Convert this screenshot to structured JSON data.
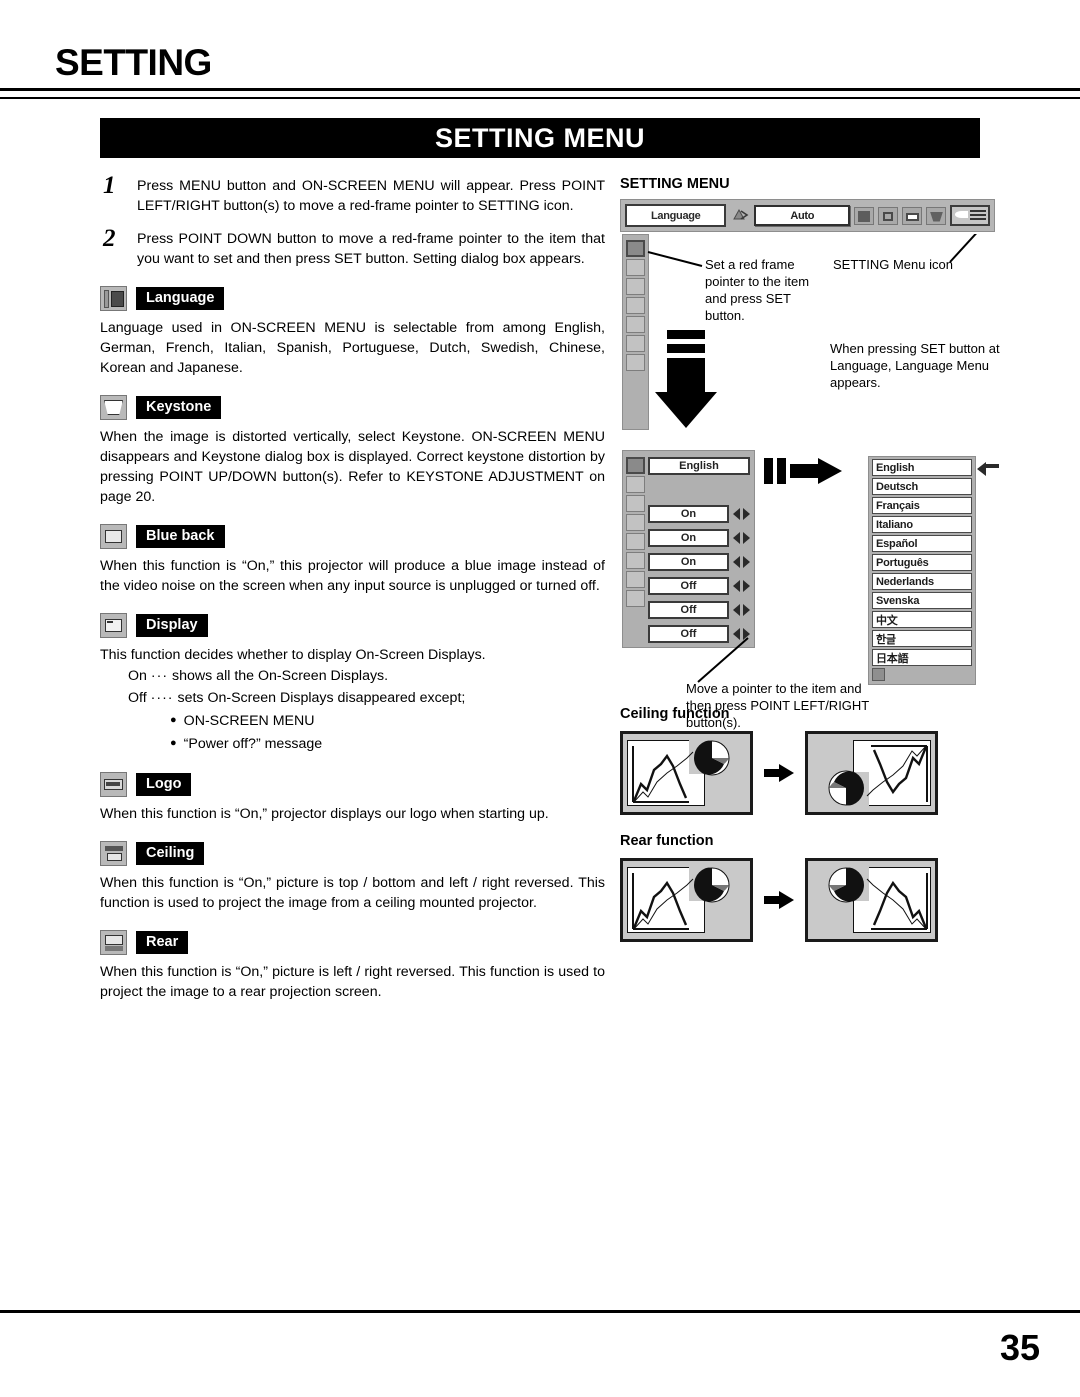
{
  "header": {
    "title": "SETTING",
    "banner": "SETTING MENU"
  },
  "steps": [
    {
      "num": "1",
      "text": "Press MENU button and ON-SCREEN MENU will appear.  Press POINT LEFT/RIGHT button(s) to move a red-frame pointer to SETTING icon."
    },
    {
      "num": "2",
      "text": "Press POINT DOWN button to move a red-frame pointer to the item that you want to set and then press SET button.  Setting dialog box appears."
    }
  ],
  "sections": [
    {
      "icon": "language-icon",
      "label": "Language",
      "body": "Language used in ON-SCREEN MENU is selectable from among English, German, French, Italian, Spanish, Portuguese, Dutch, Swedish, Chinese, Korean and Japanese."
    },
    {
      "icon": "keystone-icon",
      "label": "Keystone",
      "body": "When the image is distorted vertically, select Keystone.  ON-SCREEN MENU disappears and Keystone dialog box is displayed. Correct keystone distortion by pressing POINT UP/DOWN button(s). Refer to KEYSTONE ADJUSTMENT on page 20."
    },
    {
      "icon": "blue-back-icon",
      "label": "Blue back",
      "body": "When this function is “On,” this projector will produce a blue image instead of the video noise on the screen when any input source is unplugged or turned off."
    },
    {
      "icon": "display-icon",
      "label": "Display",
      "body": "This function decides whether to display On-Screen Displays.",
      "sub": [
        {
          "key": "On",
          "dots": "···",
          "text": "shows all the On-Screen Displays."
        },
        {
          "key": "Off",
          "dots": "····",
          "text": "sets On-Screen Displays disappeared except;"
        }
      ],
      "bullets": [
        "ON-SCREEN MENU",
        "“Power off?” message"
      ]
    },
    {
      "icon": "logo-icon",
      "label": "Logo",
      "body": "When this function is “On,” projector displays our logo when starting up."
    },
    {
      "icon": "ceiling-icon",
      "label": "Ceiling",
      "body": "When this function is “On,” picture is top / bottom and left / right reversed.  This function is used to project the image from a ceiling mounted projector."
    },
    {
      "icon": "rear-icon",
      "label": "Rear",
      "body": "When this function is “On,” picture is left / right reversed.  This function is used to project the image to a rear projection screen."
    }
  ],
  "right": {
    "menu_title": "SETTING MENU",
    "menubar": {
      "language_label": "Language",
      "auto_label": "Auto"
    },
    "callout_left": "Set a red frame pointer to the item and press SET button.",
    "callout_right": "SETTING Menu icon",
    "callout_set": "When pressing SET button at Language, Language Menu appears.",
    "callout_pointer": "Move a pointer to the item and then press POINT LEFT/RIGHT button(s).",
    "dialog_values": [
      "English",
      "",
      "On",
      "On",
      "On",
      "Off",
      "Off",
      "Off"
    ],
    "languages": [
      "English",
      "Deutsch",
      "Français",
      "Italiano",
      "Español",
      "Português",
      "Nederlands",
      "Svenska",
      "中文",
      "한글",
      "日本語"
    ],
    "ceiling_title": "Ceiling function",
    "rear_title": "Rear function"
  },
  "footer": {
    "page_number": "35"
  },
  "colors": {
    "banner_bg": "#000000",
    "label_bg": "#000000",
    "osd_gray": "#b0b0b0",
    "screen_gray": "#c9c9c9"
  }
}
